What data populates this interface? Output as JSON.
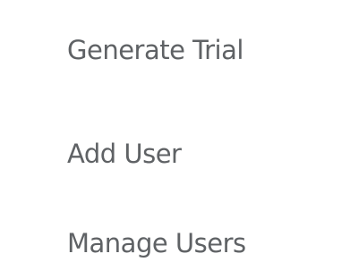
{
  "menu": {
    "items": [
      {
        "label": "Generate Trial"
      },
      {
        "label": "Add User"
      },
      {
        "label": "Manage Users"
      }
    ]
  },
  "colors": {
    "text": "#5f6265",
    "background": "#ffffff"
  }
}
